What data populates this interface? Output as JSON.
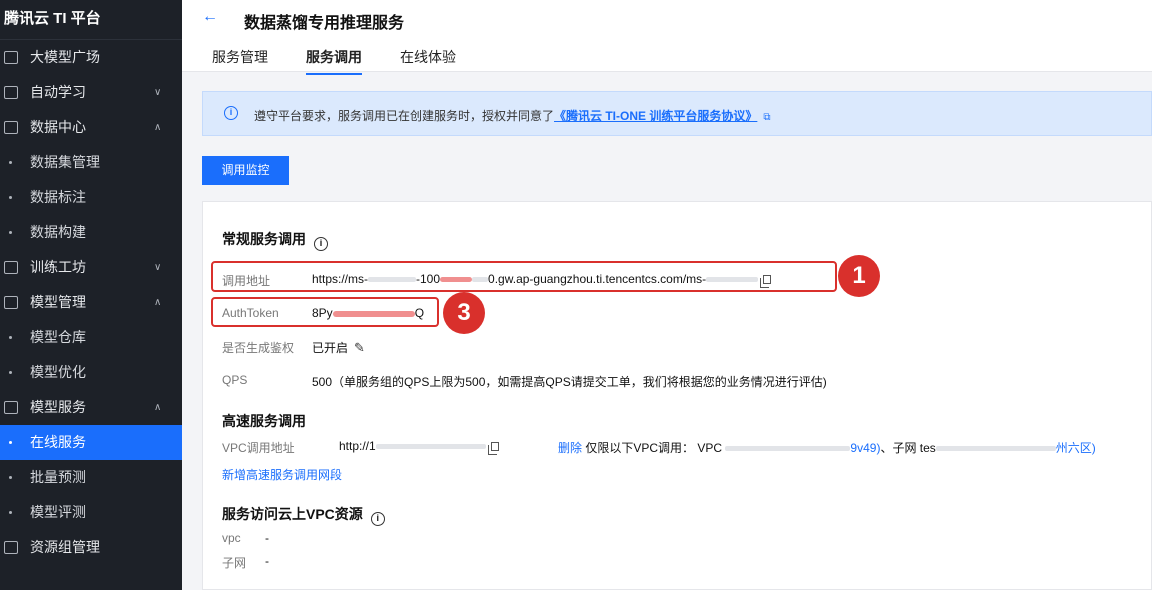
{
  "sidebar": {
    "brand": "腾讯云 TI 平台",
    "items": [
      {
        "label": "大模型广场",
        "icon": "layout-icon",
        "chevron": ""
      },
      {
        "label": "自动学习",
        "icon": "monitor-chart-icon",
        "chevron": "∨"
      },
      {
        "label": "数据中心",
        "icon": "calendar-icon",
        "chevron": "∧"
      },
      {
        "label": "数据集管理",
        "sub": true
      },
      {
        "label": "数据标注",
        "sub": true
      },
      {
        "label": "数据构建",
        "sub": true
      },
      {
        "label": "训练工坊",
        "icon": "laptop-icon",
        "chevron": "∨"
      },
      {
        "label": "模型管理",
        "icon": "cube-icon",
        "chevron": "∧"
      },
      {
        "label": "模型仓库",
        "sub": true
      },
      {
        "label": "模型优化",
        "sub": true
      },
      {
        "label": "模型服务",
        "icon": "server-icon",
        "chevron": "∧"
      },
      {
        "label": "在线服务",
        "sub": true,
        "active": true
      },
      {
        "label": "批量预测",
        "sub": true
      },
      {
        "label": "模型评测",
        "sub": true
      },
      {
        "label": "资源组管理",
        "icon": "resource-icon",
        "chevron": ""
      }
    ]
  },
  "header": {
    "back": "←",
    "title": "数据蒸馏专用推理服务",
    "tabs": [
      "服务管理",
      "服务调用",
      "在线体验"
    ],
    "active_tab": 1
  },
  "notice": {
    "text": "遵守平台要求，服务调用已在创建服务时，授权并同意了",
    "link": "《腾讯云 TI-ONE 训练平台服务协议》"
  },
  "monitor_button": "调用监控",
  "regular": {
    "title": "常规服务调用",
    "url_label": "调用地址",
    "url_a": "https://ms-",
    "url_b": "-100",
    "url_c": "0.gw.ap-guangzhou.ti.tencentcs.com/ms-",
    "token_label": "AuthToken",
    "token_a": "8Py",
    "token_b": "Q",
    "auth_label": "是否生成鉴权",
    "auth_value": "已开启",
    "qps_label": "QPS",
    "qps_value": "500（单服务组的QPS上限为500，如需提高QPS请提交工单，我们将根据您的业务情况进行评估)"
  },
  "highspeed": {
    "title": "高速服务调用",
    "vpc_label": "VPC调用地址",
    "vpc_addr": "http://1",
    "delete": "删除",
    "desc": "仅限以下VPC调用：",
    "vpc_prefix": "VPC",
    "vpc_id_tail": "9v49)",
    "subnet": "、子网 tes",
    "region_tail": "州六区)",
    "add_link": "新增高速服务调用网段"
  },
  "cloud_vpc": {
    "title": "服务访问云上VPC资源",
    "vpc_label": "vpc",
    "vpc_value": "-",
    "subnet_label": "子网",
    "subnet_value": "-"
  },
  "callouts": {
    "first": "1",
    "second": "3"
  },
  "colors": {
    "accent": "#1a6efc",
    "sidebar": "#1d2128",
    "callout": "#d9302c"
  }
}
